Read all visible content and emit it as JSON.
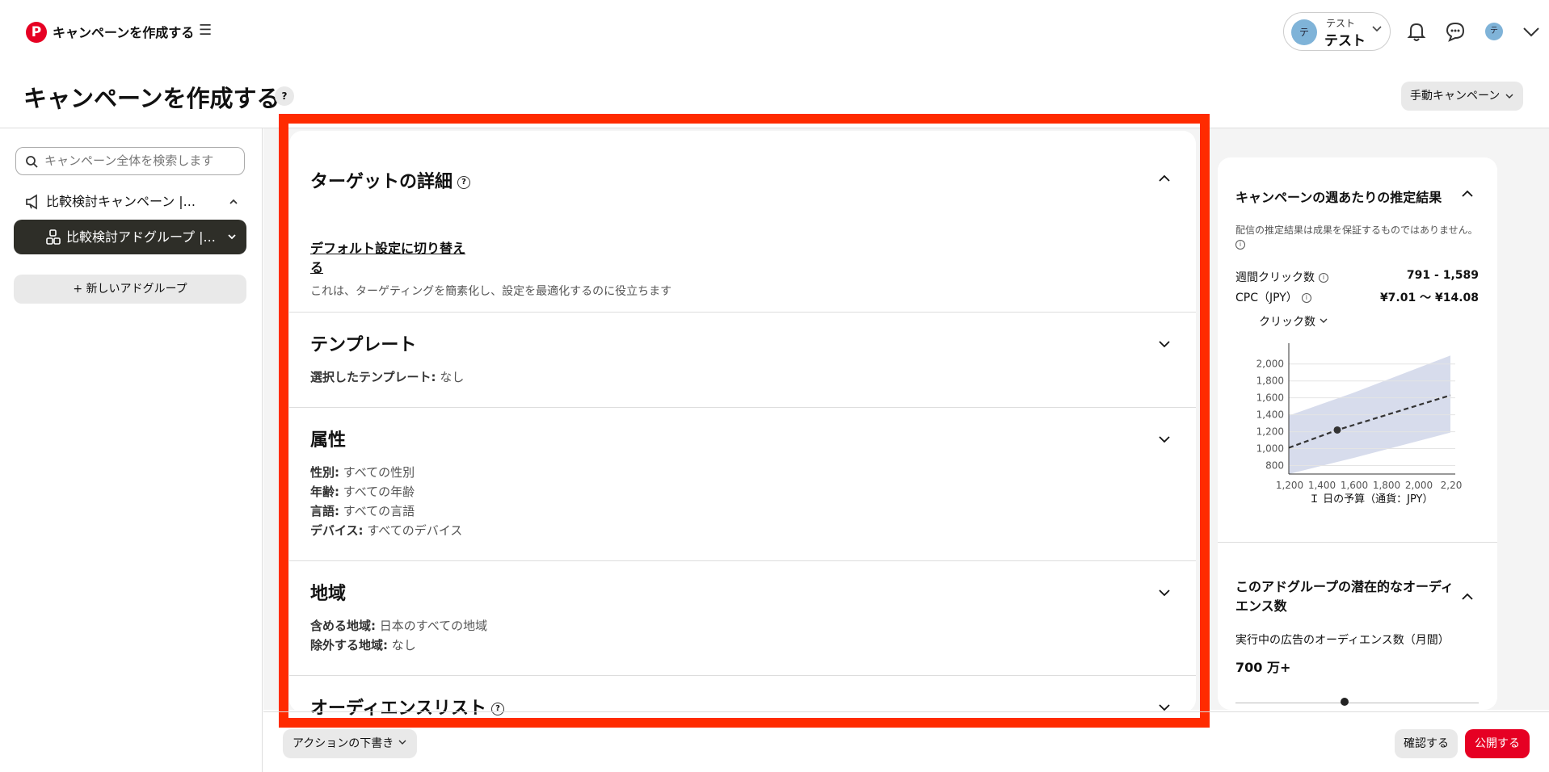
{
  "app": {
    "logo_letter": "P",
    "title": "キャンペーンを作成する",
    "menu_icon": "☰"
  },
  "account": {
    "avatar": "テ",
    "subtitle": "テスト",
    "name": "テスト"
  },
  "header": {
    "title": "キャンペーンを作成する",
    "help": "?",
    "campaign_mode": "手動キャンペーン"
  },
  "sidebar": {
    "search_placeholder": "キャンペーン全体を検索します",
    "campaign_label": "比較検討キャンペーン |...",
    "adgroup_label": "比較検討アドグループ |...",
    "new_adgroup": "+ 新しいアドグループ"
  },
  "targeting": {
    "title": "ターゲットの詳細",
    "switch_link": "デフォルト設定に切り替え\nる",
    "switch_desc": "これは、ターゲティングを簡素化し、設定を最適化するのに役立ちます"
  },
  "template": {
    "title": "テンプレート",
    "key": "選択したテンプレート:",
    "value": "なし"
  },
  "demographics": {
    "title": "属性",
    "rows": [
      {
        "key": "性別:",
        "value": "すべての性別"
      },
      {
        "key": "年齢:",
        "value": "すべての年齢"
      },
      {
        "key": "言語:",
        "value": "すべての言語"
      },
      {
        "key": "デバイス:",
        "value": "すべてのデバイス"
      }
    ]
  },
  "location": {
    "title": "地域",
    "rows": [
      {
        "key": "含める地域:",
        "value": "日本のすべての地域"
      },
      {
        "key": "除外する地域:",
        "value": "なし"
      }
    ]
  },
  "audience_list": {
    "title": "オーディエンスリスト"
  },
  "estimates": {
    "title": "キャンペーンの週あたりの推定結果",
    "disclaimer": "配信の推定結果は成果を保証するものではありません。",
    "weekly_clicks_label": "週間クリック数",
    "weekly_clicks_value": "791 - 1,589",
    "cpc_label": "CPC（JPY）",
    "cpc_value": "¥7.01 〜 ¥14.08",
    "metric_select": "クリック数",
    "x_axis_label": "Ｉ 日の予算（通貨：JPY）"
  },
  "chart_data": {
    "type": "line",
    "x": [
      1200,
      1400,
      1600,
      1800,
      2000,
      2200
    ],
    "x_tick_labels": [
      "1,200",
      "1,400",
      "1,600",
      "1,800",
      "2,000",
      "2,20"
    ],
    "y_tick_labels": [
      "800",
      "1,000",
      "1,200",
      "1,400",
      "1,600",
      "1,800",
      "2,000"
    ],
    "ylim": [
      700,
      2150
    ],
    "xlim": [
      1200,
      2200
    ],
    "series": [
      {
        "values_x": [
          1200,
          1500,
          2200
        ],
        "values": [
          1010,
          1220,
          1630
        ]
      }
    ],
    "band": {
      "x": [
        1200,
        1600,
        2200
      ],
      "upper": [
        1390,
        1660,
        2100
      ],
      "lower": [
        700,
        890,
        1190
      ]
    },
    "marker": {
      "x": 1500,
      "y": 1220
    },
    "xlabel": "Ｉ 日の予算（通貨：JPY）"
  },
  "audience": {
    "title": "このアドグループの潜在的なオーディエンス数",
    "subtitle": "実行中の広告のオーディエンス数（月間）",
    "value": "700 万+"
  },
  "footer": {
    "draft": "アクションの下書き",
    "confirm": "確認する",
    "publish": "公開する"
  }
}
